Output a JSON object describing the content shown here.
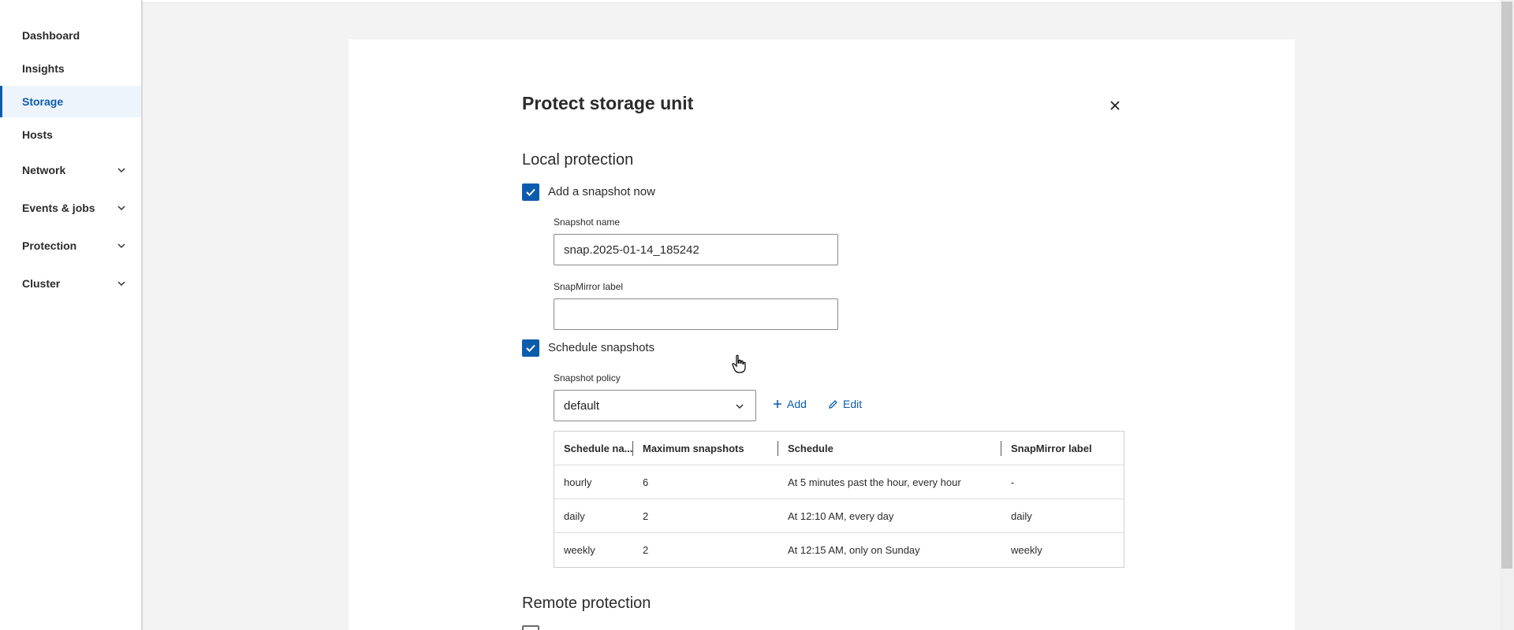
{
  "sidebar": {
    "items": [
      {
        "label": "Dashboard",
        "active": false,
        "expandable": false
      },
      {
        "label": "Insights",
        "active": false,
        "expandable": false
      },
      {
        "label": "Storage",
        "active": true,
        "expandable": false
      },
      {
        "label": "Hosts",
        "active": false,
        "expandable": false
      },
      {
        "label": "Network",
        "active": false,
        "expandable": true
      },
      {
        "label": "Events & jobs",
        "active": false,
        "expandable": true
      },
      {
        "label": "Protection",
        "active": false,
        "expandable": true
      },
      {
        "label": "Cluster",
        "active": false,
        "expandable": true
      }
    ]
  },
  "dialog": {
    "title": "Protect storage unit",
    "local_section": "Local protection",
    "add_snapshot_label": "Add a snapshot now",
    "add_snapshot_checked": true,
    "snapshot_name_label": "Snapshot name",
    "snapshot_name_value": "snap.2025-01-14_185242",
    "snapmirror_label_label": "SnapMirror label",
    "snapmirror_label_value": "",
    "schedule_label": "Schedule snapshots",
    "schedule_checked": true,
    "policy_label": "Snapshot policy",
    "policy_value": "default",
    "add_label": "Add",
    "edit_label": "Edit",
    "remote_section": "Remote protection"
  },
  "table": {
    "headers": [
      "Schedule na...",
      "Maximum snapshots",
      "Schedule",
      "SnapMirror label"
    ],
    "rows": [
      [
        "hourly",
        "6",
        "At 5 minutes past the hour, every hour",
        "-"
      ],
      [
        "daily",
        "2",
        "At 12:10 AM, every day",
        "daily"
      ],
      [
        "weekly",
        "2",
        "At 12:15 AM, only on Sunday",
        "weekly"
      ]
    ]
  },
  "colors": {
    "accent": "#0b5cad",
    "active_nav_bg": "#eef4fb",
    "page_bg": "#f3f3f3"
  }
}
